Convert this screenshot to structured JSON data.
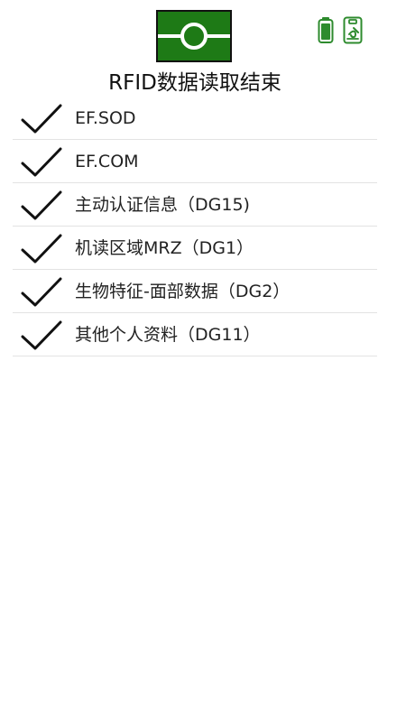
{
  "header": {
    "title": "RFID数据读取结束",
    "logo_icon": "passport-chip-icon",
    "status_icons": [
      {
        "name": "battery-icon",
        "color": "#2e8b2e"
      },
      {
        "name": "reader-device-icon",
        "color": "#2e8b2e"
      }
    ]
  },
  "status_list": {
    "check_icon": "checkmark-icon",
    "items": [
      {
        "label": "EF.SOD",
        "status": "complete"
      },
      {
        "label": "EF.COM",
        "status": "complete"
      },
      {
        "label": "主动认证信息（DG15)",
        "status": "complete"
      },
      {
        "label": "机读区域MRZ（DG1）",
        "status": "complete"
      },
      {
        "label": "生物特征-面部数据（DG2）",
        "status": "complete"
      },
      {
        "label": "其他个人资料（DG11）",
        "status": "complete"
      }
    ]
  },
  "colors": {
    "logo_green": "#1e7a16",
    "status_green": "#2e8b2e",
    "check_color": "#111111",
    "divider": "#e3e3e3",
    "background": "#ffffff"
  }
}
